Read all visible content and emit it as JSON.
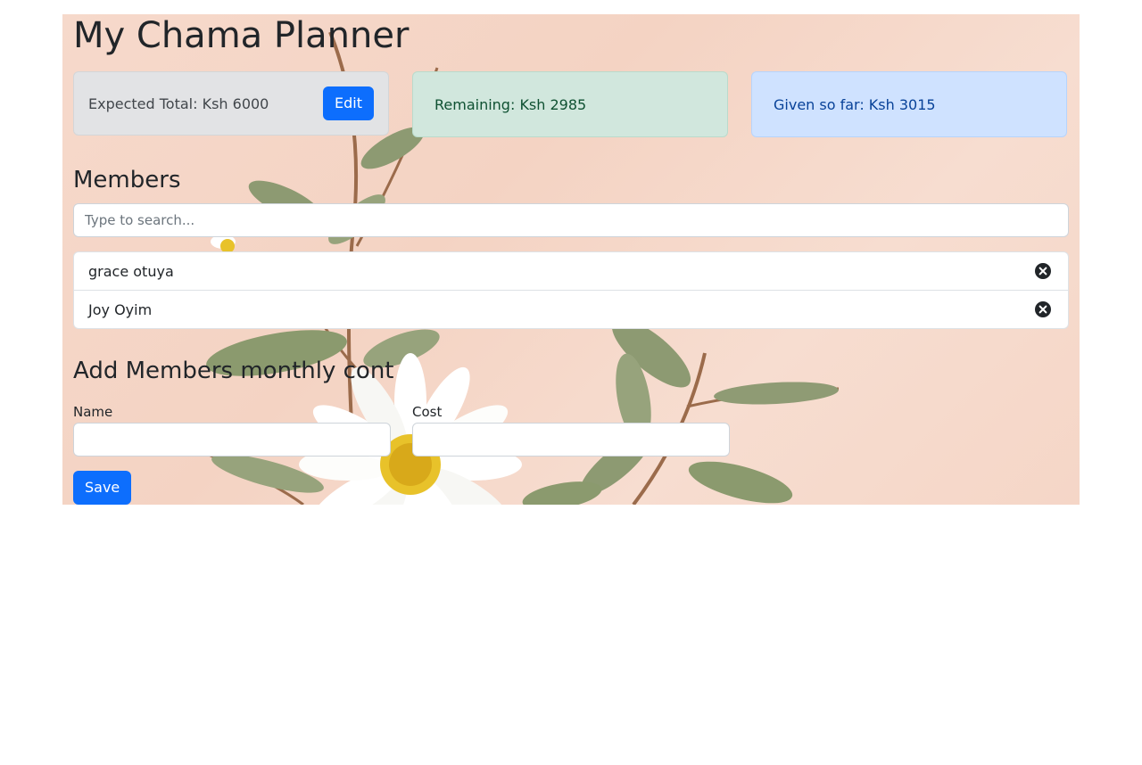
{
  "app": {
    "title": "My Chama Planner"
  },
  "summary": {
    "expected_total": "Expected Total: Ksh 6000",
    "edit_label": "Edit",
    "remaining": "Remaining: Ksh 2985",
    "given": "Given so far: Ksh 3015"
  },
  "members": {
    "title": "Members",
    "search_placeholder": "Type to search...",
    "items": [
      {
        "name": "grace otuya",
        "icon": "close-circle-icon"
      },
      {
        "name": "Joy Oyim",
        "icon": "close-circle-icon"
      }
    ]
  },
  "form": {
    "title": "Add Members monthly cont",
    "name_label": "Name",
    "cost_label": "Cost",
    "name_value": "",
    "cost_value": "",
    "save_label": "Save"
  },
  "colors": {
    "primary": "#0d6efd",
    "secondary_bg": "#e2e3e5",
    "success_bg": "#d1e7dd",
    "info_bg": "#cfe2ff"
  }
}
